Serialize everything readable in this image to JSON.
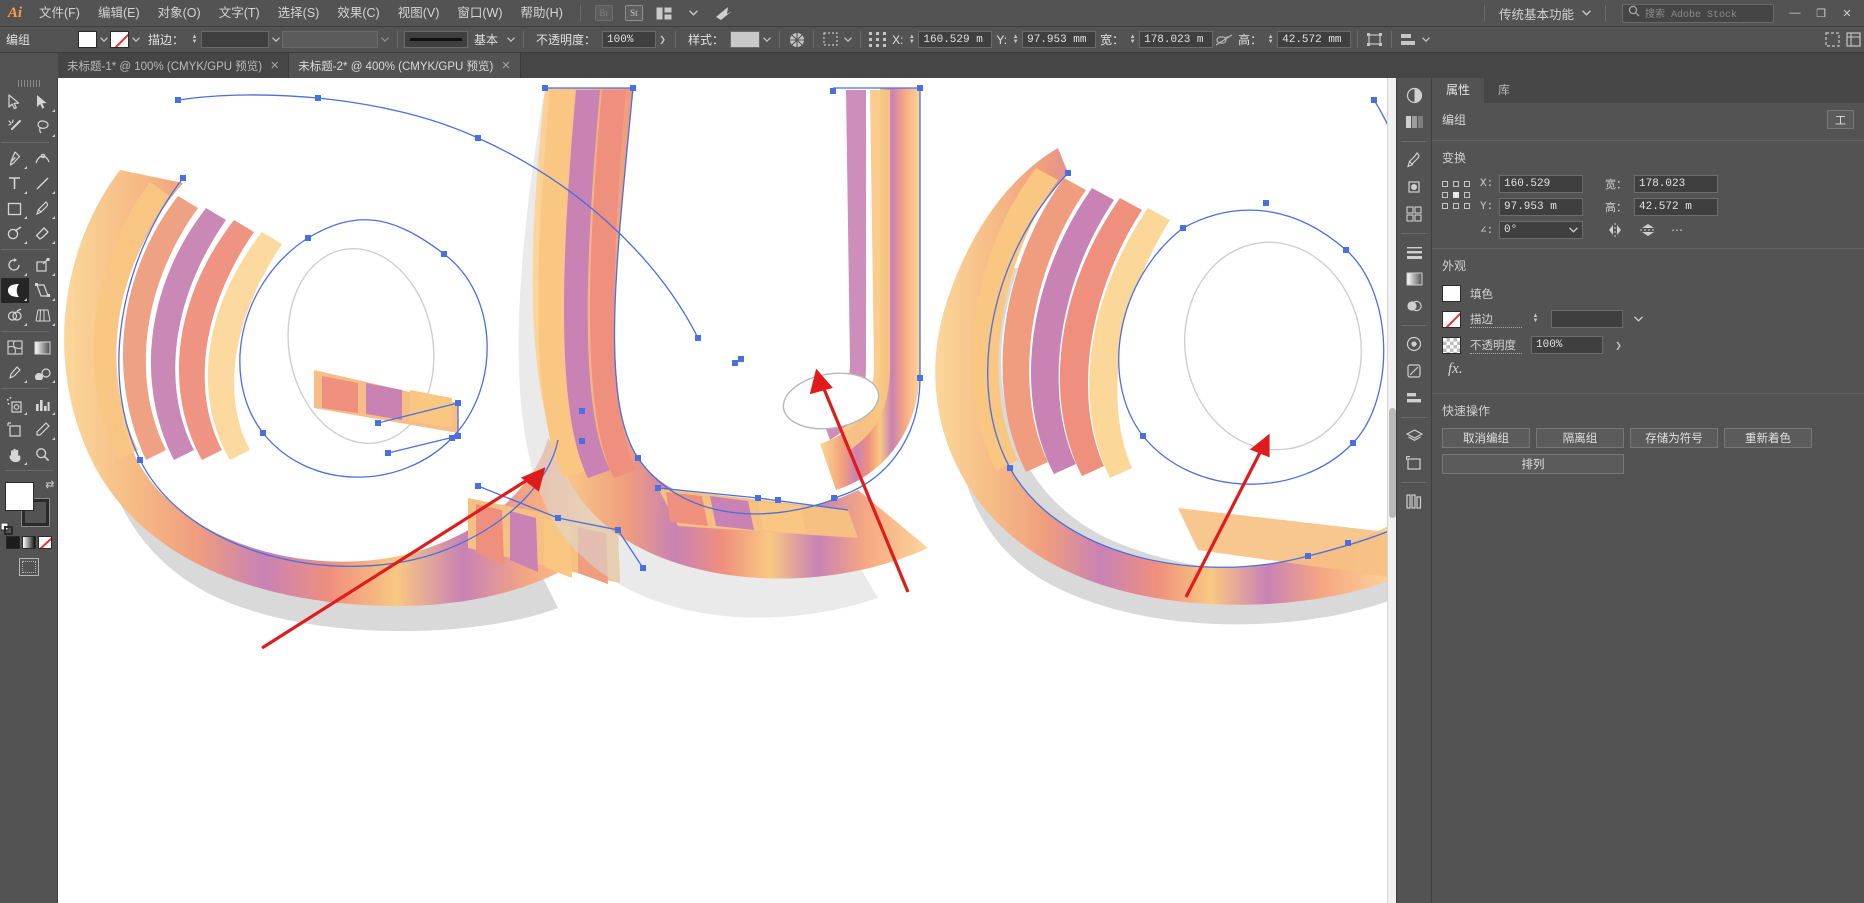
{
  "app": {
    "logo": "Ai",
    "menus": [
      {
        "label": "文件(F)"
      },
      {
        "label": "编辑(E)"
      },
      {
        "label": "对象(O)"
      },
      {
        "label": "文字(T)"
      },
      {
        "label": "选择(S)"
      },
      {
        "label": "效果(C)"
      },
      {
        "label": "视图(V)"
      },
      {
        "label": "窗口(W)"
      },
      {
        "label": "帮助(H)"
      }
    ],
    "bridge_icon_label": "Br",
    "stock_icon_label": "St",
    "arrange_docs_icon": "arrange-documents-icon",
    "workspace": "传统基本功能",
    "search_placeholder": "搜索 Adobe Stock",
    "window_minimize": "—",
    "window_restore": "❐",
    "window_close": "✕"
  },
  "controlbar": {
    "selection_label": "编组",
    "fill_swatch_color": "#ffffff",
    "stroke_swatch": "none",
    "stroke_label": "描边：",
    "stroke_weight_value": "",
    "stroke_profile_value": "",
    "brush_label": "基本",
    "opacity_label": "不透明度：",
    "opacity_value": "100%",
    "style_label": "样式：",
    "x_label": "X:",
    "x_value": "160.529 m",
    "y_label": "Y:",
    "y_value": "97.953 mm",
    "w_label": "宽：",
    "w_value": "178.023 m",
    "h_label": "高：",
    "h_value": "42.572 mm"
  },
  "tabs": [
    {
      "title": "未标题-1* @ 100% (CMYK/GPU 预览)",
      "active": false,
      "close": "✕"
    },
    {
      "title": "未标题-2* @ 400% (CMYK/GPU 预览)",
      "active": true,
      "close": "✕"
    }
  ],
  "toolbar": {
    "tools": [
      {
        "name": "selection-tool",
        "selected": false
      },
      {
        "name": "direct-selection-tool",
        "selected": false
      },
      {
        "name": "magic-wand-tool",
        "selected": false
      },
      {
        "name": "lasso-tool",
        "selected": false
      },
      {
        "name": "pen-tool",
        "selected": false
      },
      {
        "name": "curvature-tool",
        "selected": false
      },
      {
        "name": "type-tool",
        "selected": false
      },
      {
        "name": "line-segment-tool",
        "selected": false
      },
      {
        "name": "rectangle-tool",
        "selected": false
      },
      {
        "name": "paintbrush-tool",
        "selected": false
      },
      {
        "name": "shaper-tool",
        "selected": false
      },
      {
        "name": "eraser-tool",
        "selected": false
      },
      {
        "name": "rotate-tool",
        "selected": false
      },
      {
        "name": "scale-tool",
        "selected": false
      },
      {
        "name": "width-tool",
        "selected": true
      },
      {
        "name": "free-transform-tool",
        "selected": false
      },
      {
        "name": "shape-builder-tool",
        "selected": false
      },
      {
        "name": "perspective-grid-tool",
        "selected": false
      },
      {
        "name": "mesh-tool",
        "selected": false
      },
      {
        "name": "gradient-tool",
        "selected": false
      },
      {
        "name": "eyedropper-tool",
        "selected": false
      },
      {
        "name": "blend-tool",
        "selected": false
      },
      {
        "name": "symbol-sprayer-tool",
        "selected": false
      },
      {
        "name": "column-graph-tool",
        "selected": false
      },
      {
        "name": "artboard-tool",
        "selected": false
      },
      {
        "name": "slice-tool",
        "selected": false
      },
      {
        "name": "hand-tool",
        "selected": false
      },
      {
        "name": "zoom-tool",
        "selected": false
      }
    ],
    "fill_color": "#ffffff",
    "stroke_color": "#2b2b2b"
  },
  "properties": {
    "panel_tabs": [
      {
        "label": "属性",
        "active": true
      },
      {
        "label": "库",
        "active": false
      }
    ],
    "selection_type": "编组",
    "selection_action": "工",
    "transform": {
      "title": "变换",
      "x_label": "X:",
      "x_value": "160.529",
      "y_label": "Y:",
      "y_value": "97.953 m",
      "w_label": "宽：",
      "w_value": "178.023",
      "h_label": "高：",
      "h_value": "42.572 m",
      "angle_label": "∠:",
      "angle_value": "0°",
      "flip_h_icon": "flip-horizontal-icon",
      "flip_v_icon": "flip-vertical-icon",
      "more_options": "⋯"
    },
    "appearance": {
      "title": "外观",
      "fill_label": "填色",
      "fill_color": "#ffffff",
      "stroke_label": "描边",
      "stroke_value": "",
      "opacity_label": "不透明度",
      "opacity_value": "100%",
      "fx_label": "fx."
    },
    "quick_actions": {
      "title": "快速操作",
      "buttons": [
        {
          "label": "取消编组"
        },
        {
          "label": "隔离组"
        },
        {
          "label": "存储为符号"
        },
        {
          "label": "重新着色"
        },
        {
          "label": "排列"
        }
      ]
    }
  },
  "canvas": {
    "artwork_description": "striped-3d-letters-QUO",
    "stripe_colors": [
      "#f9c77f",
      "#f3a27d",
      "#b87ab0",
      "#f08a78",
      "#fbd79a"
    ],
    "shadow_color": "#d4d4d4",
    "path_outline_color": "#4a6fe0",
    "anchor_color": "#4a6fe0",
    "annotation_arrow_color": "#e01b1b",
    "annotations": [
      {
        "name": "arrow-lower-left",
        "points_to": "notched-stripe-edge-on-Q"
      },
      {
        "name": "arrow-middle",
        "points_to": "overlapping-loop-on-U"
      },
      {
        "name": "arrow-right",
        "points_to": "stripe-edge-on-O"
      }
    ]
  }
}
